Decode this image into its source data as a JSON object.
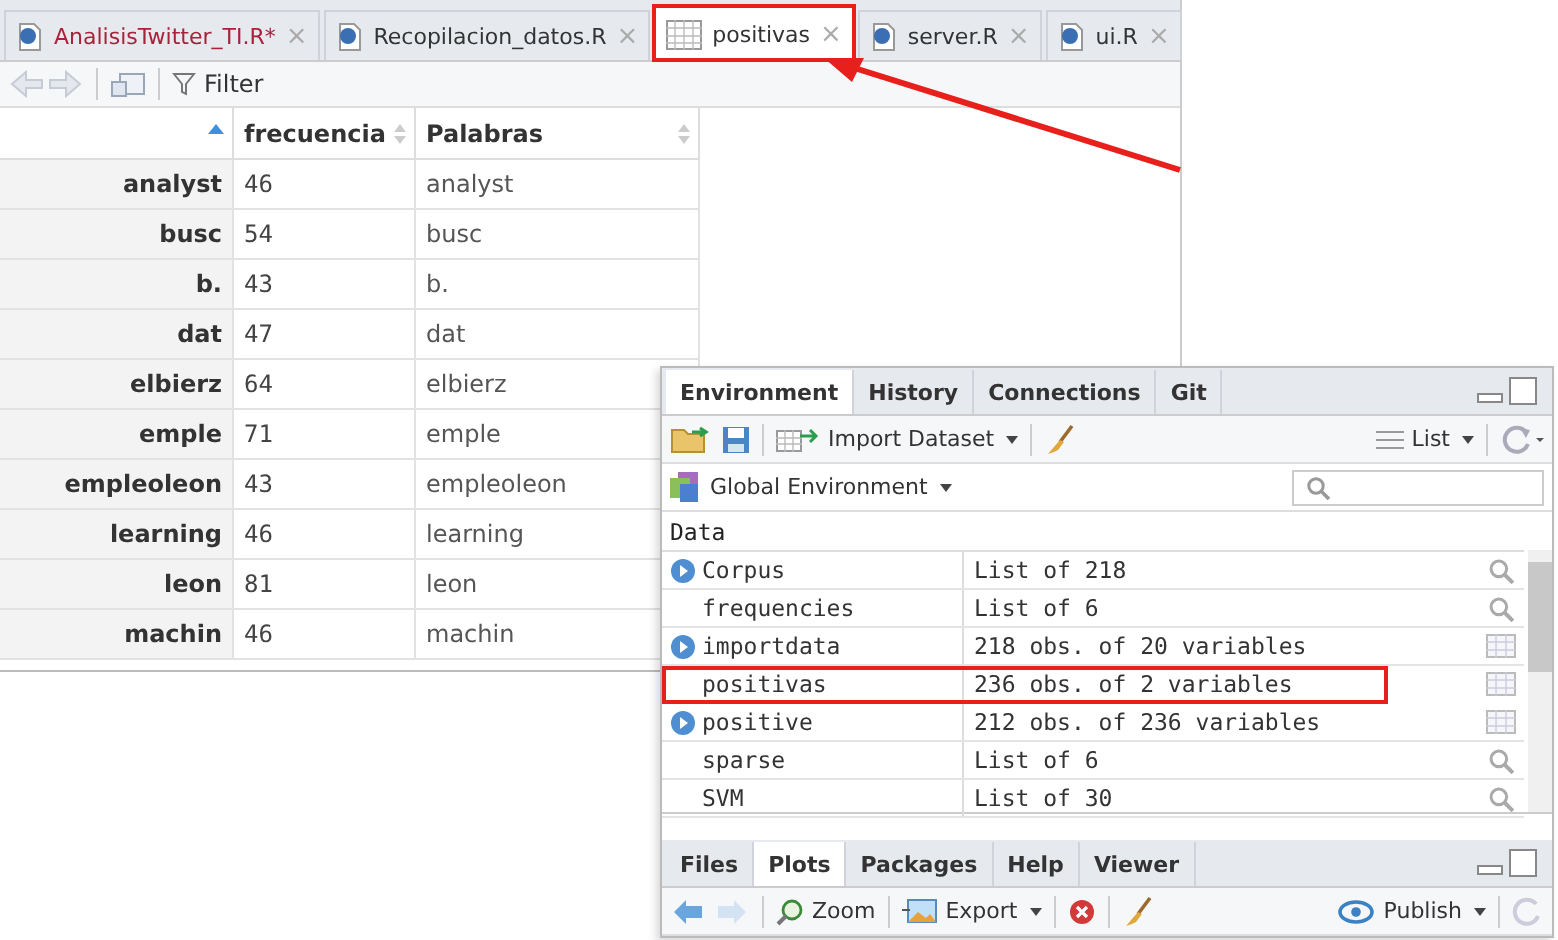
{
  "editor_tabs": [
    {
      "label": "AnalisisTwitter_TI.R*",
      "kind": "r",
      "modified": true,
      "selected": false,
      "highlighted": false
    },
    {
      "label": "Recopilacion_datos.R",
      "kind": "r",
      "modified": false,
      "selected": false,
      "highlighted": false
    },
    {
      "label": "positivas",
      "kind": "grid",
      "modified": false,
      "selected": true,
      "highlighted": true
    },
    {
      "label": "server.R",
      "kind": "r",
      "modified": false,
      "selected": false,
      "highlighted": false
    },
    {
      "label": "ui.R",
      "kind": "r",
      "modified": false,
      "selected": false,
      "highlighted": false
    }
  ],
  "close_glyph": "×",
  "viewer_toolbar": {
    "filter_label": "Filter"
  },
  "table": {
    "columns": [
      {
        "sorted": true
      },
      {
        "label": "frecuencia",
        "sorted": false
      },
      {
        "label": "Palabras",
        "sorted": false
      }
    ],
    "rows": [
      [
        "analyst",
        "46",
        "analyst"
      ],
      [
        "busc",
        "54",
        "busc"
      ],
      [
        "b.",
        "43",
        "b."
      ],
      [
        "dat",
        "47",
        "dat"
      ],
      [
        "elbierz",
        "64",
        "elbierz"
      ],
      [
        "emple",
        "71",
        "emple"
      ],
      [
        "empleoleon",
        "43",
        "empleoleon"
      ],
      [
        "learning",
        "46",
        "learning"
      ],
      [
        "leon",
        "81",
        "leon"
      ],
      [
        "machin",
        "46",
        "machin"
      ]
    ]
  },
  "environment_pane": {
    "tabs": [
      {
        "label": "Environment",
        "selected": true
      },
      {
        "label": "History",
        "selected": false
      },
      {
        "label": "Connections",
        "selected": false
      },
      {
        "label": "Git",
        "selected": false
      }
    ],
    "import_label": "Import Dataset",
    "list_label": "List",
    "scope_label": "Global Environment",
    "section": "Data",
    "rows": [
      {
        "name": "Corpus",
        "value": "List of 218",
        "expandable": true,
        "kind": "search",
        "highlighted": false
      },
      {
        "name": "frequencies",
        "value": "List of 6",
        "expandable": false,
        "kind": "search",
        "highlighted": false
      },
      {
        "name": "importdata",
        "value": "218 obs. of 20 variables",
        "expandable": true,
        "kind": "grid",
        "highlighted": false
      },
      {
        "name": "positivas",
        "value": "236 obs. of 2 variables",
        "expandable": false,
        "kind": "grid",
        "highlighted": true
      },
      {
        "name": "positive",
        "value": "212 obs. of 236 variables",
        "expandable": true,
        "kind": "grid",
        "highlighted": false
      },
      {
        "name": "sparse",
        "value": "List of 6",
        "expandable": false,
        "kind": "search",
        "highlighted": false
      },
      {
        "name": "SVM",
        "value": "List of 30",
        "expandable": false,
        "kind": "search",
        "highlighted": false
      }
    ]
  },
  "files_pane": {
    "tabs": [
      {
        "label": "Files",
        "selected": false
      },
      {
        "label": "Plots",
        "selected": true
      },
      {
        "label": "Packages",
        "selected": false
      },
      {
        "label": "Help",
        "selected": false
      },
      {
        "label": "Viewer",
        "selected": false
      }
    ],
    "zoom_label": "Zoom",
    "export_label": "Export",
    "publish_label": "Publish"
  }
}
